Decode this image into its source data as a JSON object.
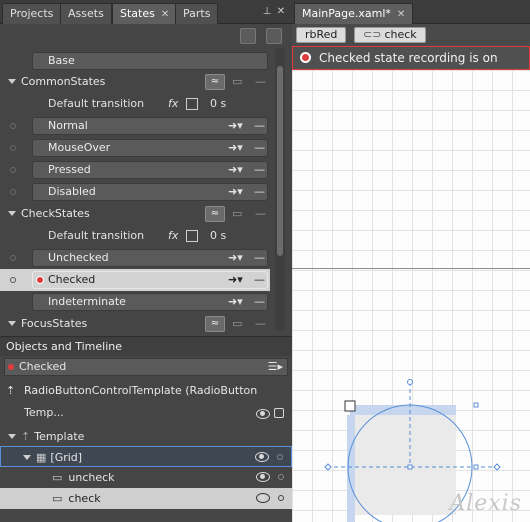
{
  "left_tabs": [
    "Projects",
    "Assets",
    "States",
    "Parts"
  ],
  "active_tab_close": "✕",
  "base_label": "Base",
  "groups": [
    {
      "name": "CommonStates",
      "default_transition": "Default transition",
      "duration": "0 s",
      "states": [
        "Normal",
        "MouseOver",
        "Pressed",
        "Disabled"
      ]
    },
    {
      "name": "CheckStates",
      "default_transition": "Default transition",
      "duration": "0 s",
      "states": [
        "Unchecked",
        "Checked",
        "Indeterminate"
      ]
    },
    {
      "name": "FocusStates"
    }
  ],
  "selected_state": "Checked",
  "fx_label": "fx",
  "otl": {
    "title": "Objects and Timeline",
    "current_state": "Checked",
    "template_path": "RadioButtonControlTemplate (RadioButton Temp...",
    "tree": [
      {
        "label": "Template",
        "level": 0
      },
      {
        "label": "[Grid]",
        "level": 1
      },
      {
        "label": "uncheck",
        "level": 2
      },
      {
        "label": "check",
        "level": 2
      }
    ]
  },
  "doc": {
    "tab": "MainPage.xaml*",
    "tab_close": "✕",
    "breadcrumb": [
      "rbRed",
      "check"
    ],
    "recording": "Checked state recording is on"
  },
  "watermark": "Alexis",
  "colors": {
    "recording": "#e23b3b",
    "selection": "#5a8fd8"
  }
}
